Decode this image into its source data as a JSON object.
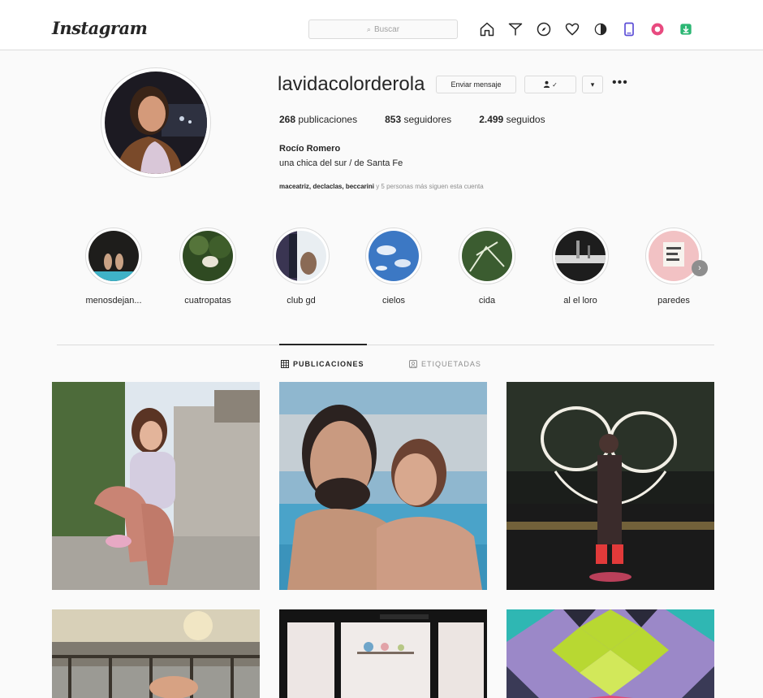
{
  "header": {
    "logo": "Instagram",
    "search_placeholder": "Buscar",
    "nav_icons": [
      "home-icon",
      "direct-icon",
      "explore-icon",
      "activity-icon",
      "theme-icon",
      "device-icon",
      "extension-icon",
      "download-icon"
    ]
  },
  "profile": {
    "username": "lavidacolorderola",
    "message_button": "Enviar mensaje",
    "follow_button": "✓",
    "dropdown_button": "▾",
    "more_button": "•••",
    "stats": {
      "posts_count": "268",
      "posts_label": "publicaciones",
      "followers_count": "853",
      "followers_label": "seguidores",
      "following_count": "2.499",
      "following_label": "seguidos"
    },
    "full_name": "Rocío Romero",
    "bio": "una chica del sur / de Santa Fe",
    "followed_by_names": "maceatriz, declaclas, beccarini",
    "followed_by_more": " y 5 personas más siguen esta cuenta"
  },
  "highlights": [
    {
      "label": "menosdejan..."
    },
    {
      "label": "cuatropatas"
    },
    {
      "label": "club gd"
    },
    {
      "label": "cielos"
    },
    {
      "label": "cida"
    },
    {
      "label": "al el loro"
    },
    {
      "label": "paredes"
    }
  ],
  "tabs": {
    "posts": "PUBLICACIONES",
    "tagged": "ETIQUETADAS"
  },
  "colors": {
    "background": "#fafafa",
    "border": "#dbdbdb",
    "text": "#262626",
    "muted": "#8e8e8e"
  }
}
